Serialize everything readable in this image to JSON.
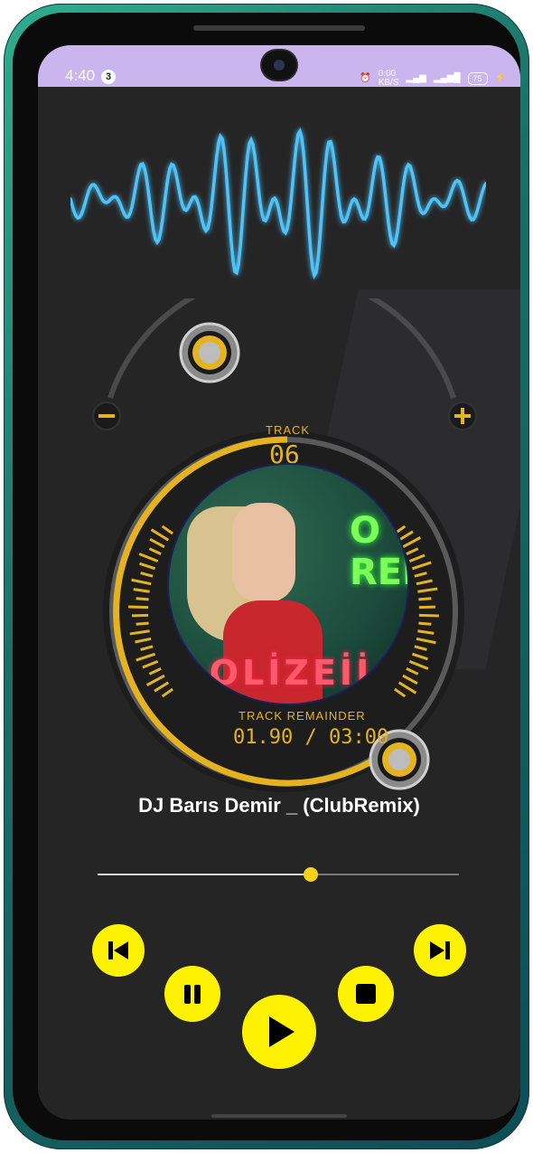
{
  "status_bar": {
    "time": "4:40",
    "notification_count": "3",
    "net_speed": "0.00",
    "net_unit": "KB/S",
    "battery": "75"
  },
  "player": {
    "track_label": "TRACK",
    "track_number": "06",
    "remainder_label": "TRACK REMAINDER",
    "remainder_value": "01.90 / 03:00",
    "song_title": "DJ Barıs Demir _ (ClubRemix)",
    "cover_neon_text": "O REM",
    "cover_word": "OLİZEİİ",
    "progress_fraction": 0.59,
    "volume_minus": "−",
    "volume_plus": "+"
  },
  "colors": {
    "accent": "#fff200",
    "gauge": "#e6b320",
    "wave": "#4fc3f7",
    "status_bar": "#cbb5ee",
    "background": "#252526"
  },
  "icons": {
    "prev": "skip-previous-icon",
    "pause": "pause-icon",
    "play": "play-icon",
    "stop": "stop-icon",
    "next": "skip-next-icon"
  }
}
